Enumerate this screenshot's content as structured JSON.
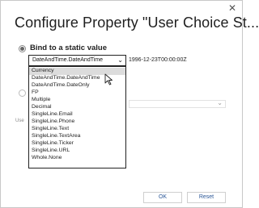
{
  "dialog": {
    "title": "Configure Property \"User Choice St..."
  },
  "static_value": {
    "label": "Bind to a static value",
    "selected_type": "DateAndTime.DateAndTime",
    "value": "1996-12-23T00:00:00Z"
  },
  "type_dropdown": {
    "items": [
      "Currency",
      "DateAndTime.DateAndTime",
      "DateAndTime.DateOnly",
      "FP",
      "Multiple",
      "Decimal",
      "SingleLine.Email",
      "SingleLine.Phone",
      "SingleLine.Text",
      "SingleLine.TextArea",
      "SingleLine.Ticker",
      "SingleLine.URL",
      "Whole.None"
    ],
    "highlighted_index": 0
  },
  "occluded_label": "Use",
  "buttons": {
    "ok": "OK",
    "reset": "Reset"
  },
  "icons": {
    "close": "close-icon",
    "chevron": "chevron-down-icon",
    "cursor": "mouse-cursor-icon"
  }
}
